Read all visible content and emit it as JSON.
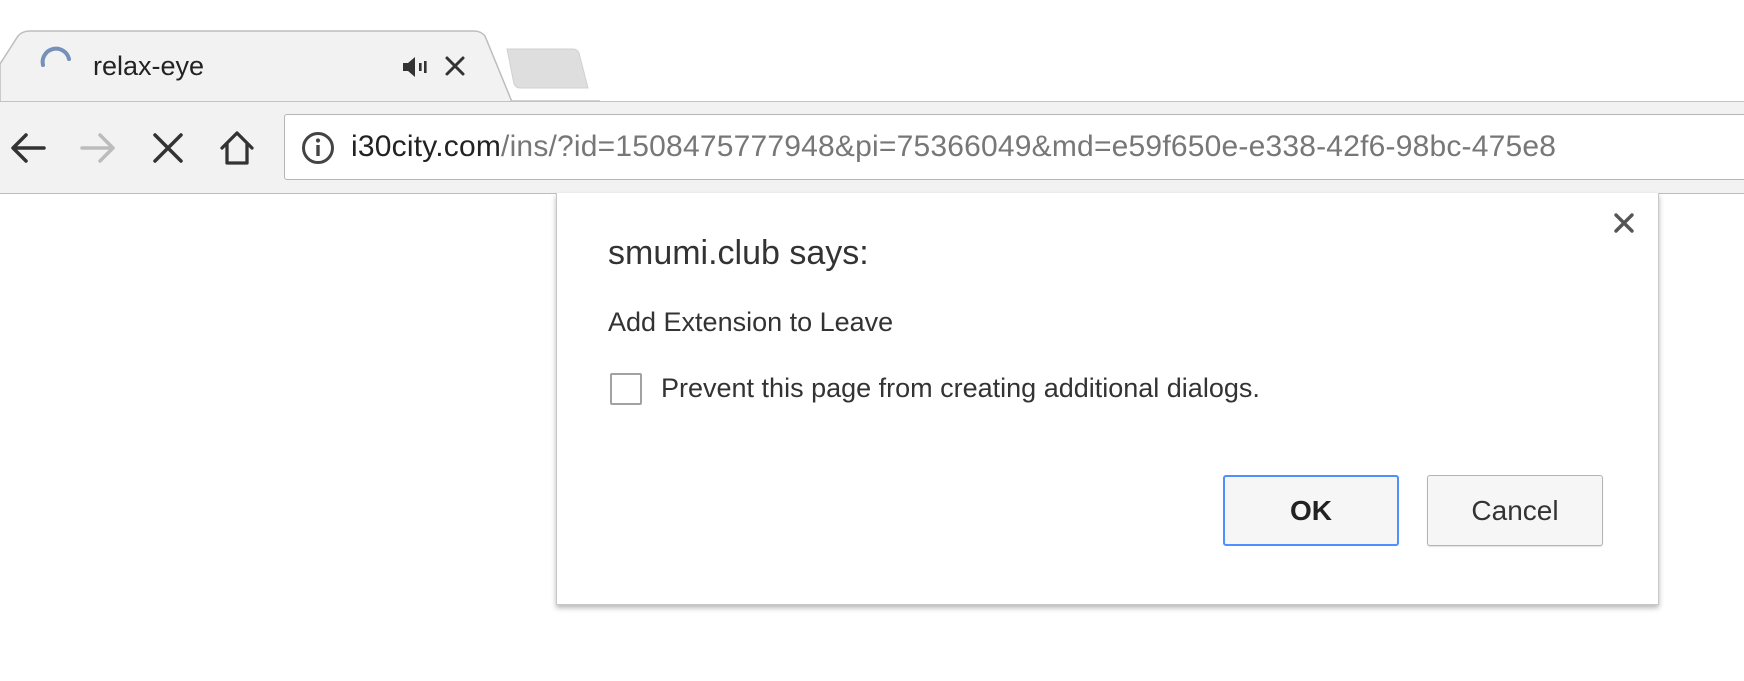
{
  "tab": {
    "title": "relax-eye",
    "status_icon": "loading-spinner-icon",
    "audio_icon": "speaker-icon",
    "close_icon": "close-icon"
  },
  "new_tab_icon": "new-tab-button",
  "toolbar": {
    "back_icon": "back-arrow-icon",
    "forward_icon": "forward-arrow-icon",
    "stop_icon": "stop-icon",
    "home_icon": "home-icon",
    "info_icon": "info-icon",
    "url_host": "i30city.com",
    "url_path": "/ins/?id=1508475777948&pi=75366049&md=e59f650e-e338-42f6-98bc-475e8"
  },
  "dialog": {
    "title": "smumi.club says:",
    "message": "Add Extension to Leave",
    "checkbox_label": "Prevent this page from creating additional dialogs.",
    "checkbox_checked": false,
    "ok_label": "OK",
    "cancel_label": "Cancel"
  },
  "colors": {
    "toolbar_bg": "#f2f2f2",
    "tab_bg": "#f2f2f2",
    "focus_ring": "#4d90fe",
    "spinner": "#4b6fa5"
  }
}
